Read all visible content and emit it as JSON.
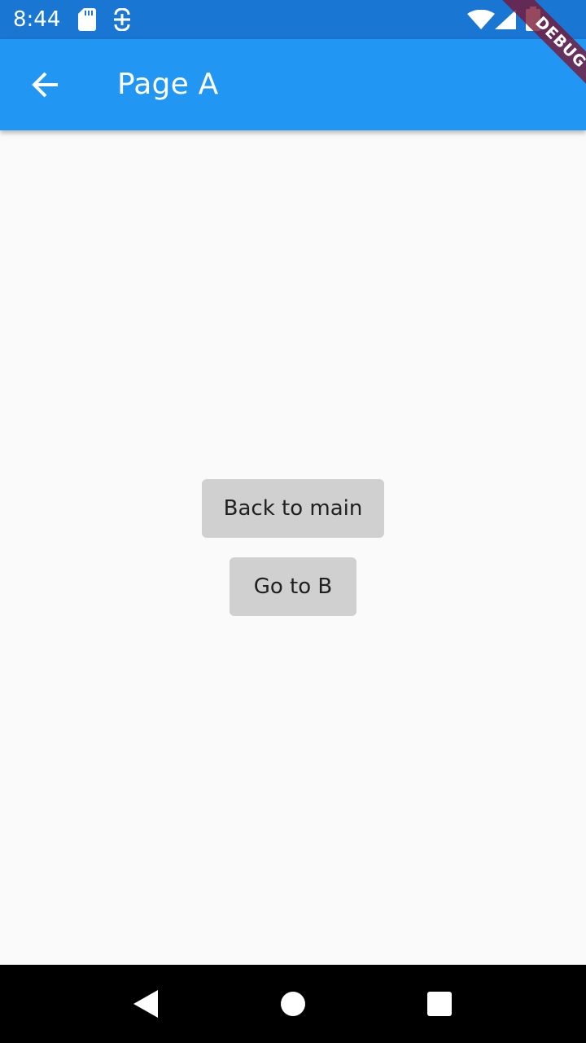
{
  "status_bar": {
    "time": "8:44",
    "icons": [
      "sd-card-icon",
      "notification-icon",
      "wifi-icon",
      "signal-icon",
      "battery-icon"
    ]
  },
  "app_bar": {
    "title": "Page A",
    "back_icon": "arrow-back-icon"
  },
  "debug_banner": {
    "label": "DEBUG"
  },
  "main": {
    "buttons": [
      {
        "label": "Back to main"
      },
      {
        "label": "Go to B"
      }
    ]
  },
  "nav_bar": {
    "icons": [
      "nav-back-icon",
      "nav-home-icon",
      "nav-recents-icon"
    ]
  },
  "colors": {
    "status_bar": "#1976d2",
    "app_bar": "#2196f3",
    "background": "#fafafa",
    "button": "#d0d0d0",
    "nav_bar": "#000000"
  }
}
